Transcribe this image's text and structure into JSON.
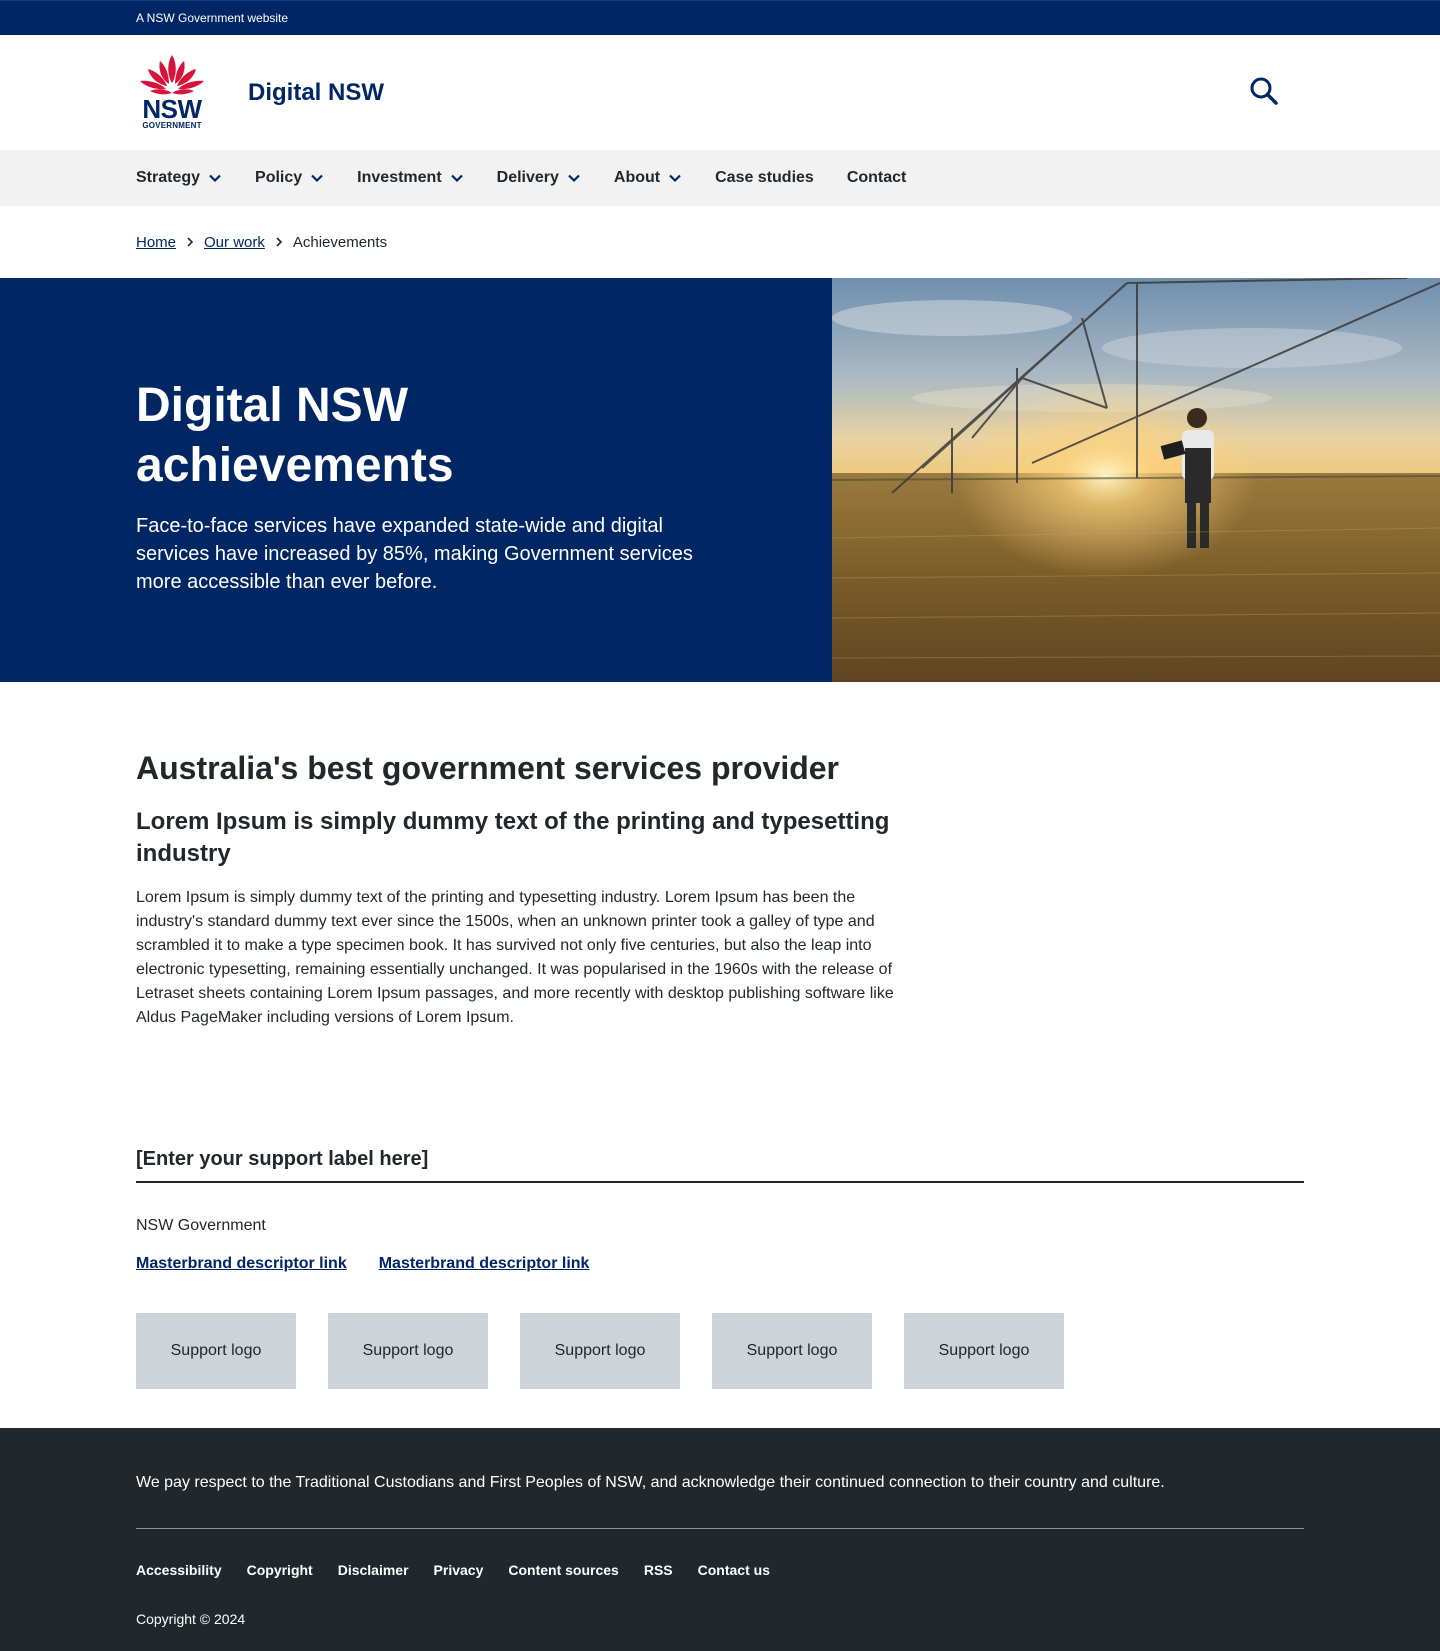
{
  "masthead": {
    "text": "A NSW Government website"
  },
  "header": {
    "logo": {
      "wordmark": "NSW",
      "sub": "GOVERNMENT"
    },
    "site_title": "Digital NSW",
    "search_icon": "search-icon"
  },
  "nav": {
    "items": [
      {
        "label": "Strategy",
        "has_dropdown": true
      },
      {
        "label": "Policy",
        "has_dropdown": true
      },
      {
        "label": "Investment",
        "has_dropdown": true
      },
      {
        "label": "Delivery",
        "has_dropdown": true
      },
      {
        "label": "About",
        "has_dropdown": true
      },
      {
        "label": "Case studies",
        "has_dropdown": false
      },
      {
        "label": "Contact",
        "has_dropdown": false
      }
    ]
  },
  "breadcrumb": {
    "items": [
      "Home",
      "Our work"
    ],
    "current": "Achievements"
  },
  "hero": {
    "title": "Digital NSW achievements",
    "intro": "Face-to-face services have expanded state-wide and digital services have increased by 85%, making Government services more accessible than ever before."
  },
  "content": {
    "heading": "Australia's best government services provider",
    "subheading": "Lorem Ipsum is simply dummy text of the printing and typesetting industry",
    "body": "Lorem Ipsum is simply dummy text of the printing and typesetting industry. Lorem Ipsum has been the industry's standard dummy text ever since the 1500s, when an unknown printer took a galley of type and scrambled it to make a type specimen book. It has survived not only five centuries, but also the leap into electronic typesetting, remaining essentially unchanged. It was popularised in the 1960s with the release of Letraset sheets containing Lorem Ipsum passages, and more recently with desktop publishing software like Aldus PageMaker including versions of Lorem Ipsum."
  },
  "support": {
    "label": "[Enter your support label here]",
    "org": "NSW Government",
    "links": [
      "Masterbrand descriptor link",
      "Masterbrand descriptor link"
    ],
    "logos": [
      "Support logo",
      "Support logo",
      "Support logo",
      "Support logo",
      "Support logo"
    ]
  },
  "footer": {
    "acknowledgement": "We pay respect to the Traditional Custodians and First Peoples of NSW, and acknowledge their continued connection to their country and culture.",
    "links": [
      "Accessibility",
      "Copyright",
      "Disclaimer",
      "Privacy",
      "Content sources",
      "RSS",
      "Contact us"
    ],
    "copyright": "Copyright © 2024"
  },
  "colors": {
    "brand_navy": "#002664",
    "brand_red": "#d7153a",
    "nav_bg": "#f2f2f2",
    "footer_bg": "#22272b",
    "support_logo_bg": "#cdd3d6"
  }
}
